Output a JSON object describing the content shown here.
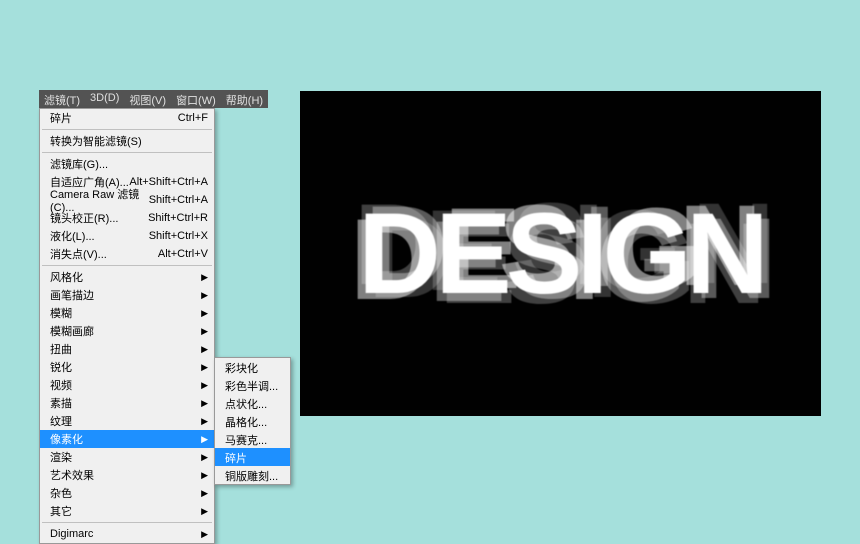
{
  "menubar": [
    "滤镜(T)",
    "3D(D)",
    "视图(V)",
    "窗口(W)",
    "帮助(H)"
  ],
  "menu": {
    "recent": {
      "label": "碎片",
      "shortcut": "Ctrl+F"
    },
    "convert": "转换为智能滤镜(S)",
    "gallery": "滤镜库(G)...",
    "adaptive": {
      "label": "自适应广角(A)...",
      "shortcut": "Alt+Shift+Ctrl+A"
    },
    "cameraraw": {
      "label": "Camera Raw 滤镜(C)...",
      "shortcut": "Shift+Ctrl+A"
    },
    "lens": {
      "label": "镜头校正(R)...",
      "shortcut": "Shift+Ctrl+R"
    },
    "liquify": {
      "label": "液化(L)...",
      "shortcut": "Shift+Ctrl+X"
    },
    "vanish": {
      "label": "消失点(V)...",
      "shortcut": "Alt+Ctrl+V"
    },
    "stylize": "风格化",
    "brush": "画笔描边",
    "blur": "模糊",
    "blurgallery": "模糊画廊",
    "distort": "扭曲",
    "sharpen": "锐化",
    "video": "视频",
    "sketch": "素描",
    "texture": "纹理",
    "pixelate": "像素化",
    "render": "渲染",
    "artistic": "艺术效果",
    "noise": "杂色",
    "other": "其它",
    "digimarc": "Digimarc"
  },
  "submenu": {
    "colorblocks": "彩块化",
    "colorhalftone": "彩色半调...",
    "pointillize": "点状化...",
    "crystallize": "晶格化...",
    "mosaic": "马赛克...",
    "fragment": "碎片",
    "mezzotint": "铜版雕刻..."
  },
  "canvas_text": "DESIGN"
}
